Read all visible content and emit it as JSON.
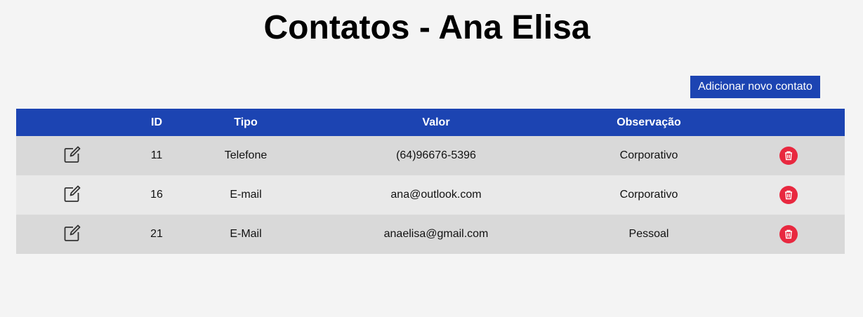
{
  "title": "Contatos - Ana Elisa",
  "add_button": "Adicionar novo contato",
  "columns": {
    "edit": "",
    "id": "ID",
    "tipo": "Tipo",
    "valor": "Valor",
    "obs": "Observação",
    "delete": ""
  },
  "rows": [
    {
      "id": "11",
      "tipo": "Telefone",
      "valor": "(64)96676-5396",
      "obs": "Corporativo"
    },
    {
      "id": "16",
      "tipo": "E-mail",
      "valor": "ana@outlook.com",
      "obs": "Corporativo"
    },
    {
      "id": "21",
      "tipo": "E-Mail",
      "valor": "anaelisa@gmail.com",
      "obs": "Pessoal"
    }
  ],
  "colors": {
    "primary": "#1c44b2",
    "danger": "#e8283f"
  }
}
